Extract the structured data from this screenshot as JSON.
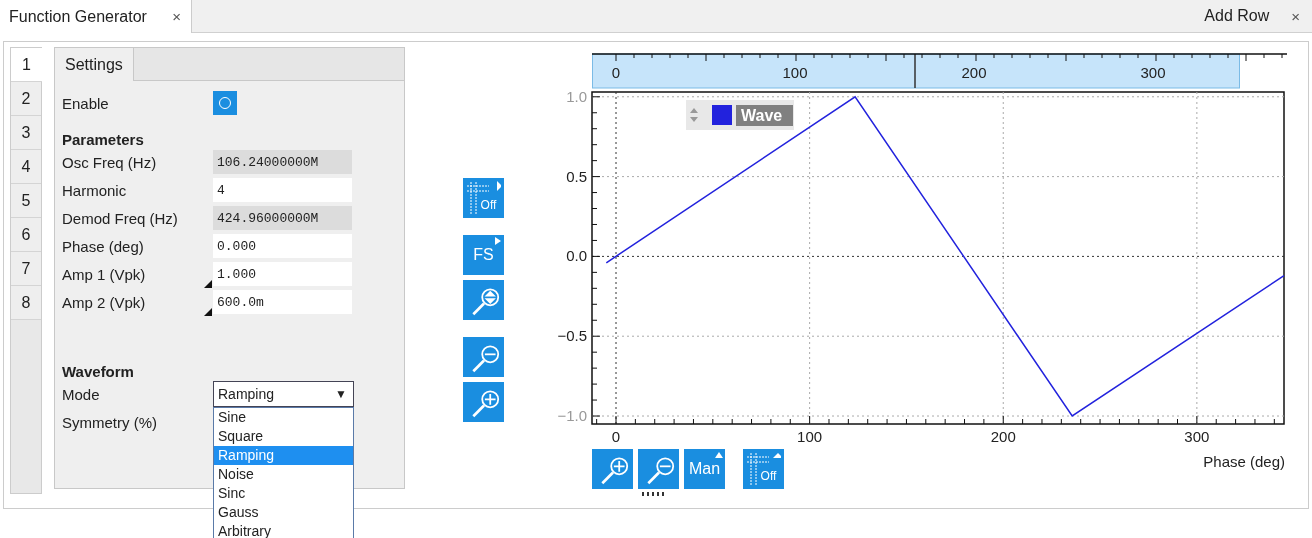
{
  "tabs": [
    {
      "label": "Function Generator",
      "close": "×",
      "selected": true
    }
  ],
  "add_row": {
    "label": "Add Row",
    "close": "×"
  },
  "channel_tabs": [
    {
      "label": "1",
      "selected": true
    },
    {
      "label": "2",
      "selected": false
    },
    {
      "label": "3",
      "selected": false
    },
    {
      "label": "4",
      "selected": false
    },
    {
      "label": "5",
      "selected": false
    },
    {
      "label": "6",
      "selected": false
    },
    {
      "label": "7",
      "selected": false
    },
    {
      "label": "8",
      "selected": false
    }
  ],
  "settings": {
    "tab": "Settings",
    "enable": {
      "label": "Enable",
      "on": false
    },
    "parameters_heading": "Parameters",
    "parameters": [
      {
        "label": "Osc Freq (Hz)",
        "value": "106.24000000M",
        "disabled": true,
        "marker": false
      },
      {
        "label": "Harmonic",
        "value": "4",
        "disabled": false,
        "marker": false
      },
      {
        "label": "Demod Freq (Hz)",
        "value": "424.96000000M",
        "disabled": true,
        "marker": false
      },
      {
        "label": "Phase (deg)",
        "value": "0.000",
        "disabled": false,
        "marker": false
      },
      {
        "label": "Amp 1 (Vpk)",
        "value": "1.000",
        "disabled": false,
        "marker": true
      },
      {
        "label": "Amp 2 (Vpk)",
        "value": "600.0m",
        "disabled": false,
        "marker": true
      }
    ],
    "waveform_heading": "Waveform",
    "mode": {
      "label": "Mode",
      "value": "Ramping",
      "arrow": "▼",
      "options": [
        {
          "label": "Sine",
          "selected": false
        },
        {
          "label": "Square",
          "selected": false
        },
        {
          "label": "Ramping",
          "selected": true
        },
        {
          "label": "Noise",
          "selected": false
        },
        {
          "label": "Sinc",
          "selected": false
        },
        {
          "label": "Gauss",
          "selected": false
        },
        {
          "label": "Arbitrary",
          "selected": false
        }
      ]
    },
    "symmetry": {
      "label": "Symmetry (%)"
    }
  },
  "side_toolbar": [
    [
      {
        "kind": "cursor",
        "label": "Off"
      }
    ],
    [
      {
        "kind": "scale",
        "label": "FS"
      },
      {
        "kind": "zoom_fit"
      }
    ],
    [
      {
        "kind": "zoom_out"
      },
      {
        "kind": "zoom_in"
      }
    ]
  ],
  "overview": {
    "tick_labels": [
      "0",
      "100",
      "200",
      "300"
    ]
  },
  "chart": {
    "chart_data": {
      "type": "line",
      "grid": true,
      "xlabel": "Phase (deg)",
      "x": [
        -5,
        123.5,
        235.6,
        345
      ],
      "series": [
        {
          "name": "Wave",
          "color": "#2222dd",
          "values": [
            -0.04,
            1.0,
            -1.0,
            -0.12
          ]
        }
      ],
      "xlim": [
        -12.4,
        345
      ],
      "ylim": [
        -1.05,
        1.03
      ],
      "xticks": [
        0,
        100,
        200,
        300
      ],
      "yticks": [
        {
          "value": -1,
          "label": "−1.0"
        },
        {
          "value": -0.5,
          "label": "−0.5"
        },
        {
          "value": 0,
          "label": "0.0"
        },
        {
          "value": 0.5,
          "label": "0.5"
        },
        {
          "value": 1,
          "label": "1.0"
        }
      ]
    }
  },
  "bottom_toolbar": [
    [
      {
        "kind": "zoom_in"
      },
      {
        "kind": "zoom_out"
      },
      {
        "kind": "scale",
        "label": "Man"
      }
    ],
    [
      {
        "kind": "cursor",
        "label": "Off"
      }
    ]
  ]
}
